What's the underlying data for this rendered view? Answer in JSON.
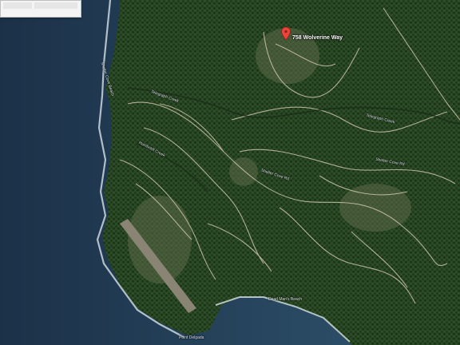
{
  "map": {
    "marker": {
      "label": "758 Wolverine Way",
      "color": "#e8453c"
    },
    "labels": {
      "creek_upper_left": "Telegraph Creek",
      "creek_upper_right": "Telegraph Creek",
      "beach_left": "Shelter Cove Beach",
      "creek_middle": "Humboldt Creek",
      "road_middle": "Shelter Cove Rd",
      "road_right": "Shelter Cove Rd",
      "beach_bottom": "Dead Man's Beach",
      "point": "Point Delgada"
    }
  },
  "colors": {
    "ocean_deep": "#1d3650",
    "ocean_shallow": "#30546e",
    "forest_dark": "#1f3a1c",
    "forest": "#304f29",
    "terrain_light": "#6b7055",
    "road": "#c9c2a8",
    "surf": "#e3ecf0"
  },
  "icons": {
    "marker": "map-pin-icon"
  }
}
